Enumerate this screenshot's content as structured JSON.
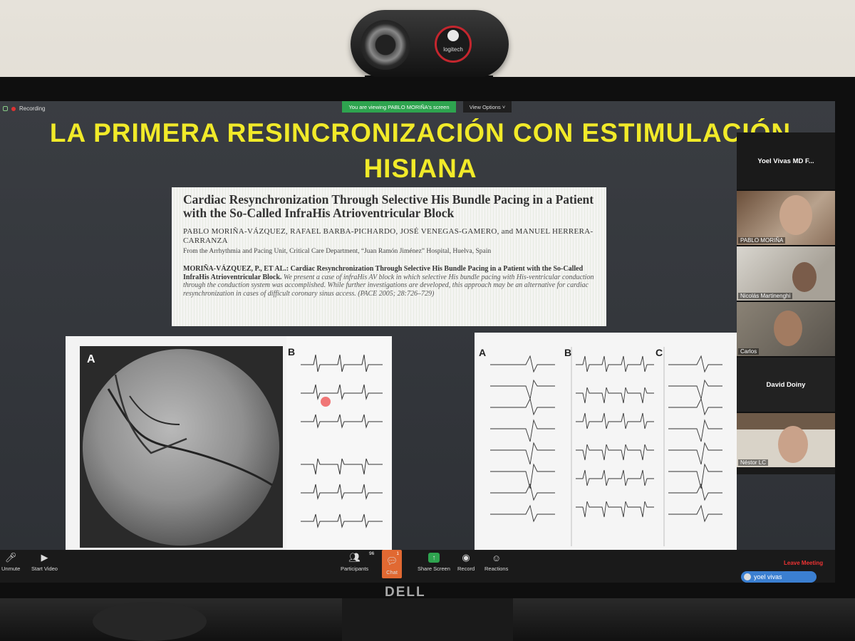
{
  "topbar": {
    "recording": "Recording",
    "viewing": "You are viewing PABLO MORIÑA's screen",
    "view_options": "View Options ˅"
  },
  "slide": {
    "title_line1": "LA PRIMERA RESINCRONIZACIÓN CON ESTIMULACIÓN",
    "title_line2": "HISIANA",
    "paper": {
      "title": "Cardiac Resynchronization Through Selective His Bundle Pacing in a Patient with the So-Called InfraHis Atrioventricular Block",
      "authors": "PABLO MORIÑA-VÁZQUEZ, RAFAEL BARBA-PICHARDO, JOSÉ VENEGAS-GAMERO, and MANUEL HERRERA-CARRANZA",
      "affiliation": "From the Arrhythmia and Pacing Unit, Critical Care Department, “Juan Ramón Jiménez” Hospital, Huelva, Spain",
      "abstract_bold": "MORIÑA-VÁZQUEZ, P., ET AL.: Cardiac Resynchronization Through Selective His Bundle Pacing in a Patient with the So-Called InfraHis Atrioventricular Block.",
      "abstract_italic": "We present a case of infraHis AV block in which selective His bundle pacing with His-ventricular conduction through the conduction system was accomplished. While further investigations are developed, this approach may be an alternative for cardiac resynchronization in cases of difficult coronary sinus access.",
      "citation": "(PACE 2005; 28:726–729)"
    },
    "fig_left": {
      "label_a": "A",
      "label_b": "B"
    },
    "fig_right": {
      "label_a": "A",
      "label_b": "B",
      "label_c": "C"
    }
  },
  "participants": {
    "host": "Yoel Vivas MD F...",
    "tiles": [
      {
        "name": "PABLO MORIÑA"
      },
      {
        "name": "Nicolás Martinenghi"
      },
      {
        "name": "Carlos"
      },
      {
        "name": "David Doiny"
      },
      {
        "name": "Néstor LC"
      }
    ]
  },
  "toolbar": {
    "unmute": "Unmute",
    "start_video": "Start Video",
    "participants": "Participants",
    "participants_count": "96",
    "chat": "Chat",
    "chat_count": "1",
    "share": "Share Screen",
    "record": "Record",
    "reactions": "Reactions",
    "leave": "Leave Meeting",
    "bubble_name": "yoel vivas"
  },
  "monitor": {
    "brand": "DELL",
    "webcam_brand": "logitech"
  }
}
